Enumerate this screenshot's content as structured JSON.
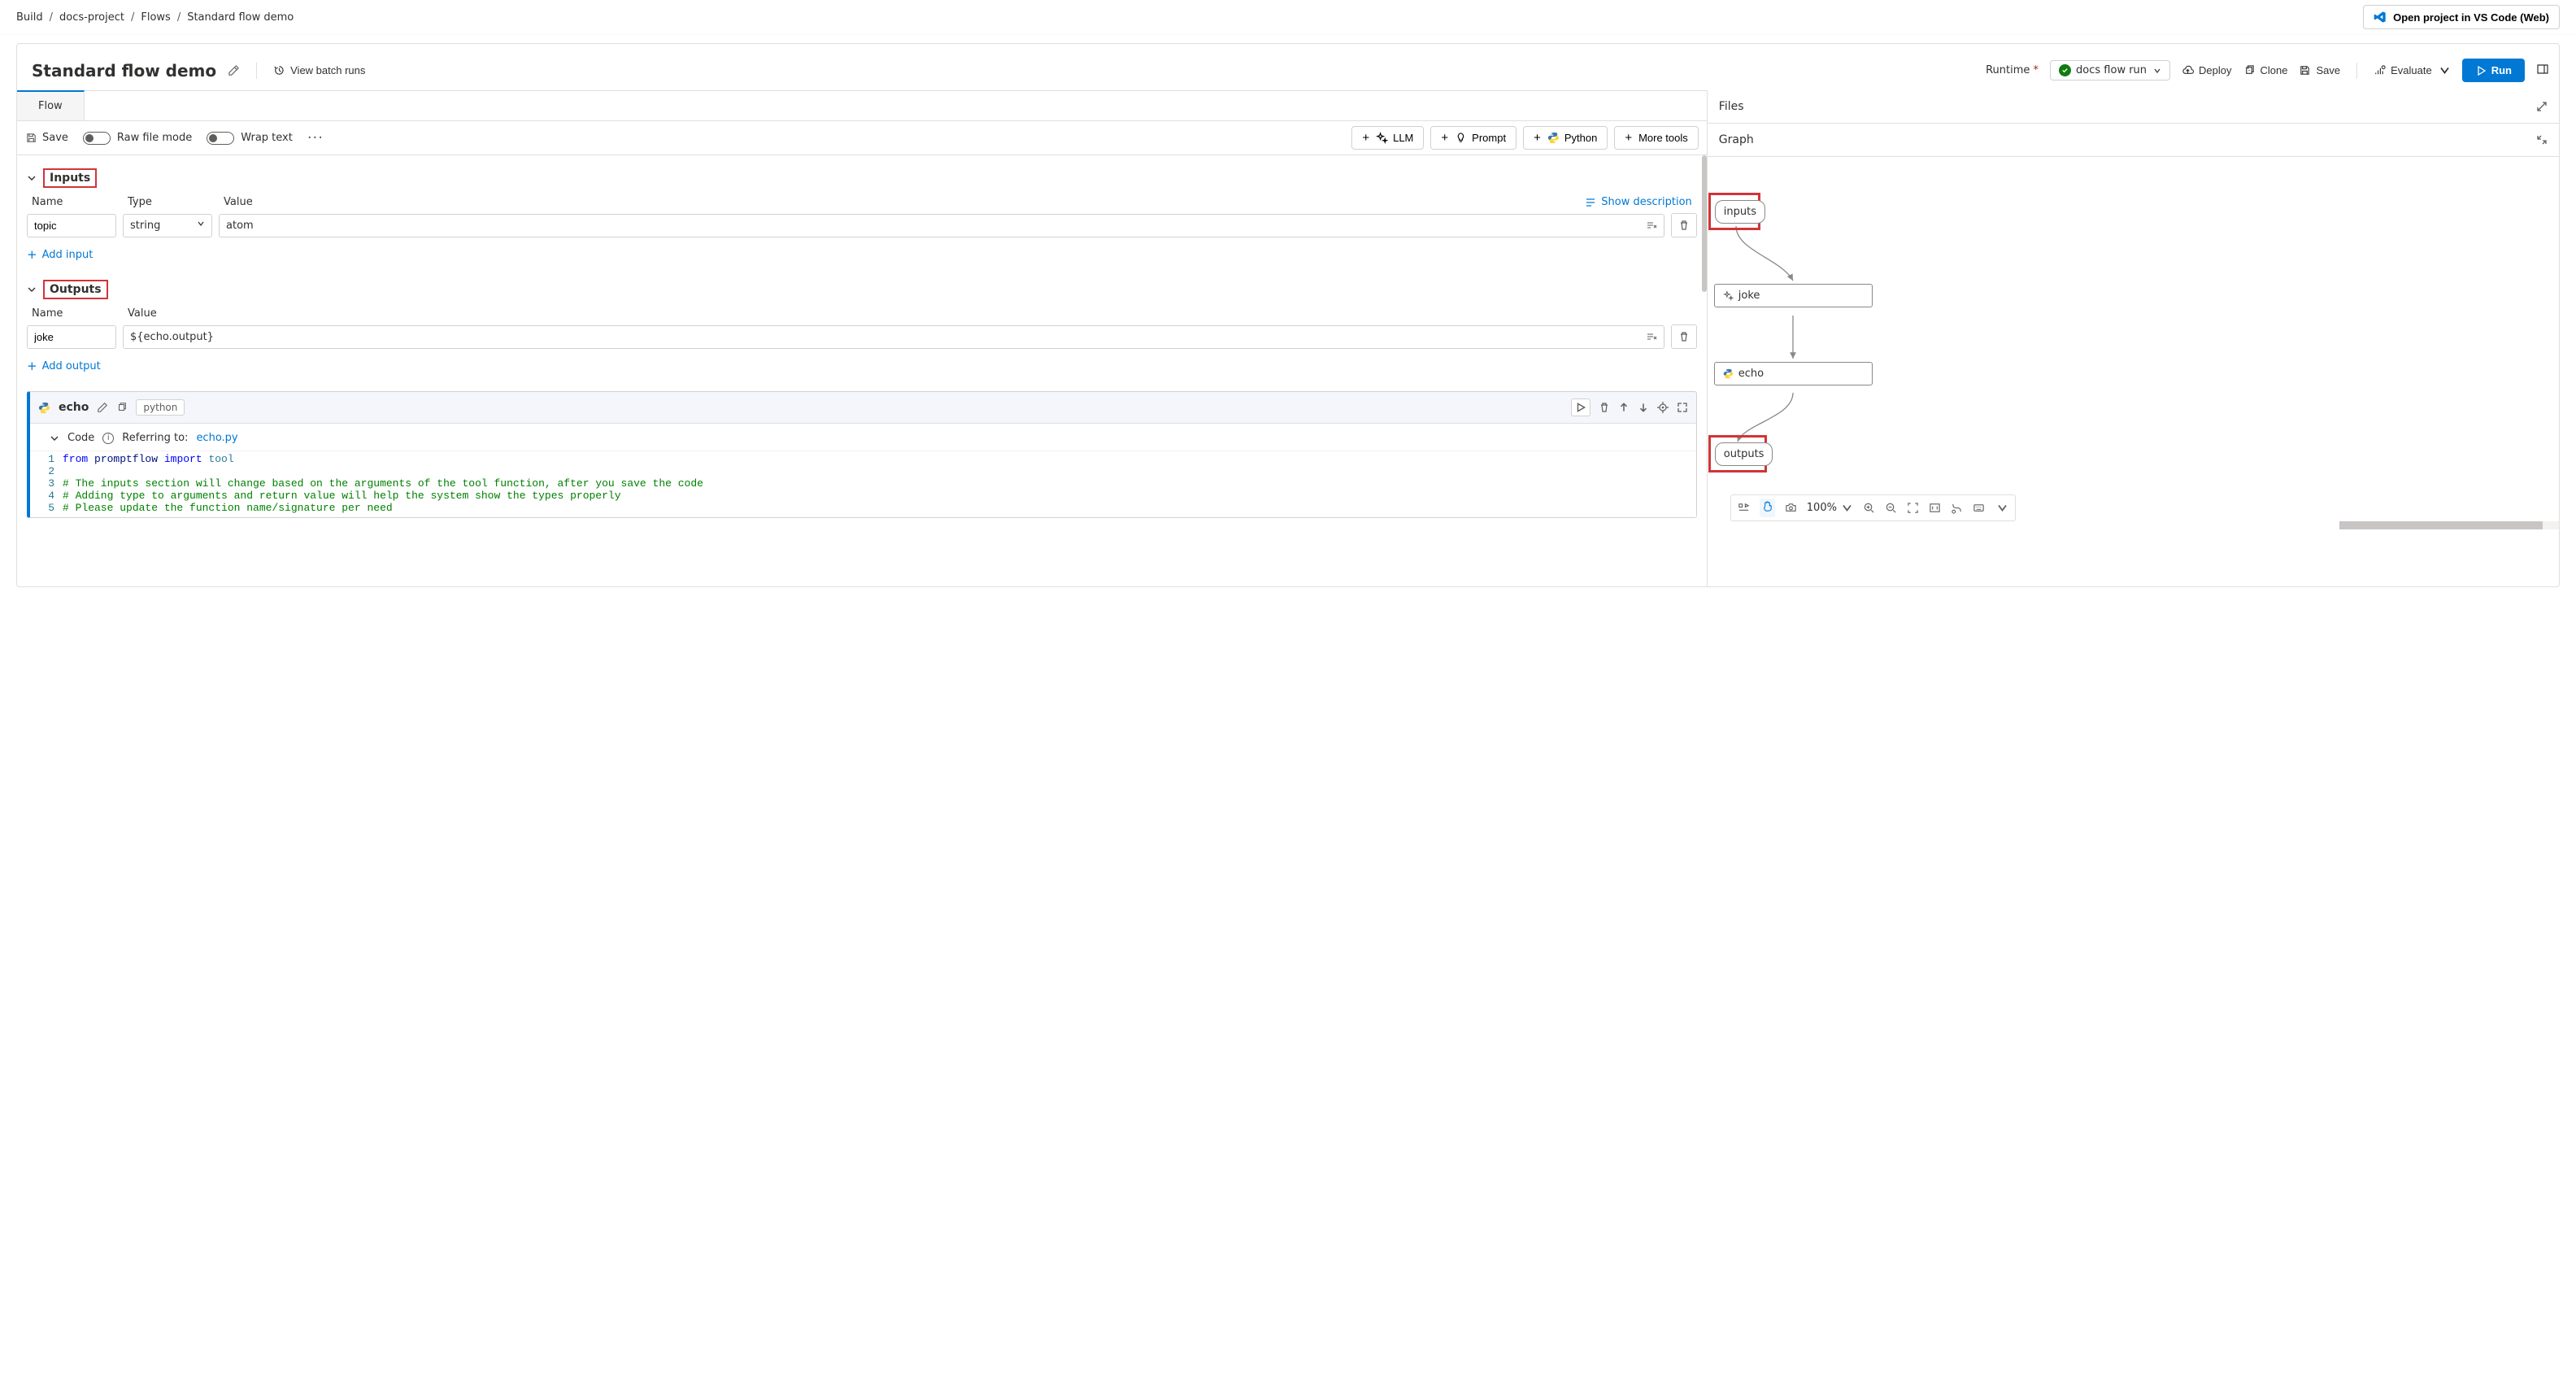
{
  "breadcrumb": [
    "Build",
    "docs-project",
    "Flows",
    "Standard flow demo"
  ],
  "vscode_btn": "Open project in VS Code (Web)",
  "title": "Standard flow demo",
  "view_batch": "View batch runs",
  "runtime_label": "Runtime",
  "runtime_value": "docs flow run",
  "actions": {
    "deploy": "Deploy",
    "clone": "Clone",
    "save": "Save",
    "evaluate": "Evaluate",
    "run": "Run"
  },
  "tab_flow": "Flow",
  "toolbar": {
    "save": "Save",
    "raw": "Raw file mode",
    "wrap": "Wrap text",
    "llm": "LLM",
    "prompt": "Prompt",
    "python": "Python",
    "more": "More tools"
  },
  "inputs": {
    "heading": "Inputs",
    "cols": {
      "name": "Name",
      "type": "Type",
      "value": "Value"
    },
    "show_desc": "Show description",
    "row": {
      "name": "topic",
      "type": "string",
      "value": "atom"
    },
    "add": "Add input"
  },
  "outputs": {
    "heading": "Outputs",
    "cols": {
      "name": "Name",
      "value": "Value"
    },
    "row": {
      "name": "joke",
      "value": "${echo.output}"
    },
    "add": "Add output"
  },
  "node": {
    "name": "echo",
    "tag": "python",
    "code_label": "Code",
    "referring": "Referring to:",
    "file": "echo.py",
    "code": {
      "l1a": "from",
      "l1b": " promptflow ",
      "l1c": "import",
      "l1d": " tool",
      "l3": "# The inputs section will change based on the arguments of the tool function, after you save the code",
      "l4": "# Adding type to arguments and return value will help the system show the types properly",
      "l5": "# Please update the function name/signature per need"
    }
  },
  "right": {
    "files": "Files",
    "graph": "Graph",
    "zoom": "100%"
  },
  "graph_nodes": {
    "inputs": "inputs",
    "joke": "joke",
    "echo": "echo",
    "outputs": "outputs"
  }
}
